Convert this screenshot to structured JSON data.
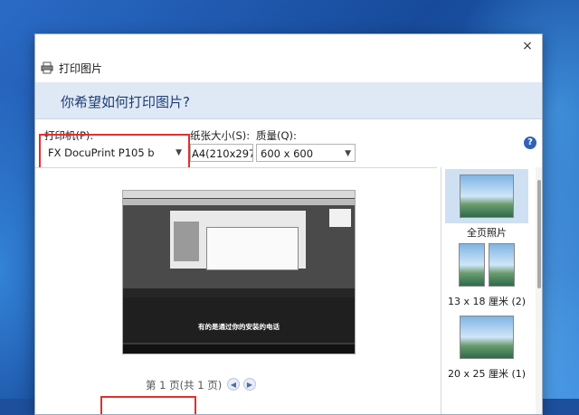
{
  "window": {
    "title": "打印图片",
    "close_symbol": "×"
  },
  "header": {
    "prompt": "你希望如何打印图片?"
  },
  "printer": {
    "label": "打印机(P):",
    "value": "FX DocuPrint P105 b"
  },
  "paper_size": {
    "label": "纸张大小(S):",
    "value": "A4(210x297"
  },
  "quality": {
    "label": "质量(Q):",
    "value": "600 x 600"
  },
  "help": {
    "symbol": "?"
  },
  "preview": {
    "caption": "有的是通过你的安装的电话",
    "page_indicator": "第 1 页(共 1 页)"
  },
  "layouts": [
    {
      "label": "全页照片",
      "selected": true
    },
    {
      "label": "13 x 18 厘米 (2)",
      "selected": false
    },
    {
      "label": "20 x 25 厘米 (1)",
      "selected": false
    }
  ],
  "colors": {
    "highlight": "#e03030",
    "banner": "#dfe9f6",
    "accent": "#2f63b5"
  }
}
